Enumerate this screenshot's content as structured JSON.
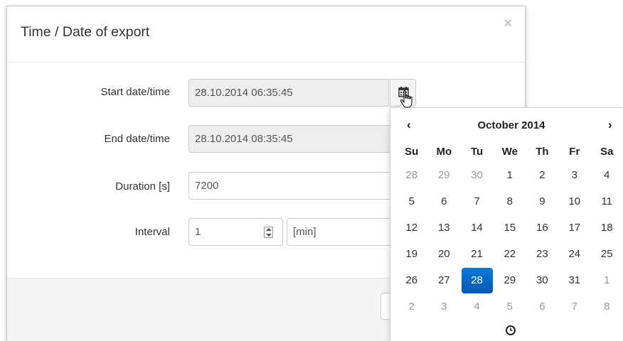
{
  "modal": {
    "title": "Time / Date of export",
    "close_label": "×"
  },
  "form": {
    "start": {
      "label": "Start date/time",
      "value": "28.10.2014 06:35:45"
    },
    "end": {
      "label": "End date/time",
      "value": "28.10.2014 08:35:45"
    },
    "duration": {
      "label": "Duration [s]",
      "value": "7200"
    },
    "interval": {
      "label": "Interval",
      "value": "1",
      "unit": "[min]"
    }
  },
  "datepicker": {
    "prev_label": "‹",
    "next_label": "›",
    "month_label": "October 2014",
    "weekdays": [
      "Su",
      "Mo",
      "Tu",
      "We",
      "Th",
      "Fr",
      "Sa"
    ],
    "weeks": [
      [
        {
          "d": "28",
          "c": "old"
        },
        {
          "d": "29",
          "c": "old"
        },
        {
          "d": "30",
          "c": "old"
        },
        {
          "d": "1",
          "c": ""
        },
        {
          "d": "2",
          "c": ""
        },
        {
          "d": "3",
          "c": ""
        },
        {
          "d": "4",
          "c": ""
        }
      ],
      [
        {
          "d": "5",
          "c": ""
        },
        {
          "d": "6",
          "c": ""
        },
        {
          "d": "7",
          "c": ""
        },
        {
          "d": "8",
          "c": ""
        },
        {
          "d": "9",
          "c": ""
        },
        {
          "d": "10",
          "c": ""
        },
        {
          "d": "11",
          "c": ""
        }
      ],
      [
        {
          "d": "12",
          "c": ""
        },
        {
          "d": "13",
          "c": ""
        },
        {
          "d": "14",
          "c": ""
        },
        {
          "d": "15",
          "c": ""
        },
        {
          "d": "16",
          "c": ""
        },
        {
          "d": "17",
          "c": ""
        },
        {
          "d": "18",
          "c": ""
        }
      ],
      [
        {
          "d": "19",
          "c": ""
        },
        {
          "d": "20",
          "c": ""
        },
        {
          "d": "21",
          "c": ""
        },
        {
          "d": "22",
          "c": ""
        },
        {
          "d": "23",
          "c": ""
        },
        {
          "d": "24",
          "c": ""
        },
        {
          "d": "25",
          "c": ""
        }
      ],
      [
        {
          "d": "26",
          "c": ""
        },
        {
          "d": "27",
          "c": ""
        },
        {
          "d": "28",
          "c": "active"
        },
        {
          "d": "29",
          "c": ""
        },
        {
          "d": "30",
          "c": ""
        },
        {
          "d": "31",
          "c": ""
        },
        {
          "d": "1",
          "c": "new"
        }
      ],
      [
        {
          "d": "2",
          "c": "new"
        },
        {
          "d": "3",
          "c": "new"
        },
        {
          "d": "4",
          "c": "new"
        },
        {
          "d": "5",
          "c": "new"
        },
        {
          "d": "6",
          "c": "new"
        },
        {
          "d": "7",
          "c": "new"
        },
        {
          "d": "8",
          "c": "new"
        }
      ]
    ],
    "clock_icon": "clock-icon",
    "calendar_icon": "calendar-icon"
  },
  "colors": {
    "active_day": "#0166c8",
    "readonly_bg": "#eeeeee",
    "muted_day": "#9a9a9a"
  }
}
